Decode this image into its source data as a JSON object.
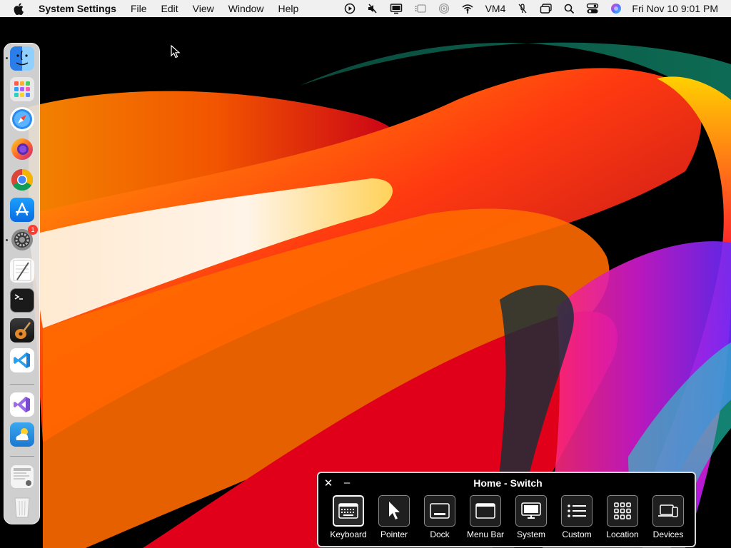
{
  "menubar": {
    "app_name": "System Settings",
    "menus": [
      "File",
      "Edit",
      "View",
      "Window",
      "Help"
    ],
    "status_text": "VM4",
    "clock": "Fri Nov 10  9:01 PM"
  },
  "dock": {
    "items": [
      "Finder",
      "Launchpad",
      "Safari",
      "Firefox",
      "Google Chrome",
      "App Store",
      "System Settings",
      "TextEdit",
      "Terminal",
      "GarageBand",
      "Visual Studio Code",
      "Visual Studio",
      "Weather",
      "Downloads",
      "Trash"
    ],
    "system_settings_badge": "1"
  },
  "panel": {
    "title": "Home - Switch",
    "close_label": "✕",
    "minimize_label": "–",
    "buttons": [
      "Keyboard",
      "Pointer",
      "Dock",
      "Menu Bar",
      "System",
      "Custom",
      "Location",
      "Devices"
    ]
  }
}
